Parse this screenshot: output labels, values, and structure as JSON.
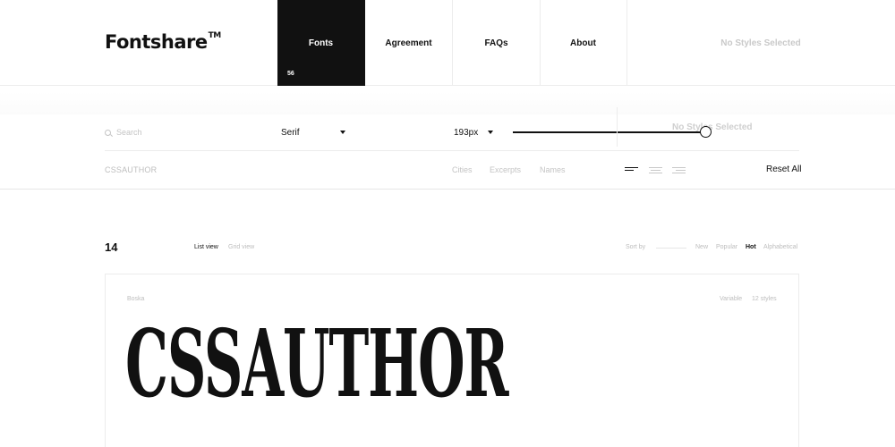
{
  "header": {
    "logo": "Fontshare",
    "logo_mark": "TM",
    "nav": [
      {
        "label": "Fonts",
        "badge": "56"
      },
      {
        "label": "Agreement"
      },
      {
        "label": "FAQs"
      },
      {
        "label": "About"
      }
    ],
    "styles_status": "No Styles Selected"
  },
  "controls": {
    "search_placeholder": "Search",
    "category_select": "Serif",
    "size_select": "193px",
    "size_slider_fraction": 0.98,
    "styles_status": "No Styles Selected",
    "preview_text": "CSSAUTHOR",
    "presets": [
      "Cities",
      "Excerpts",
      "Names"
    ],
    "align_icons": [
      "align-left-icon",
      "align-center-icon",
      "align-right-icon"
    ],
    "reset_label": "Reset All"
  },
  "listing": {
    "count": "14",
    "views": [
      {
        "label": "List view",
        "active": true
      },
      {
        "label": "Grid view",
        "active": false
      }
    ],
    "sort_label": "Sort by",
    "sort_options": [
      {
        "label": "New",
        "active": false
      },
      {
        "label": "Popular",
        "active": false
      },
      {
        "label": "Hot",
        "active": true
      },
      {
        "label": "Alphabetical",
        "active": false
      }
    ]
  },
  "card": {
    "font_name": "Boska",
    "variable_label": "Variable",
    "styles_count": "12 styles",
    "sample_text": "CSSAUTHOR"
  }
}
